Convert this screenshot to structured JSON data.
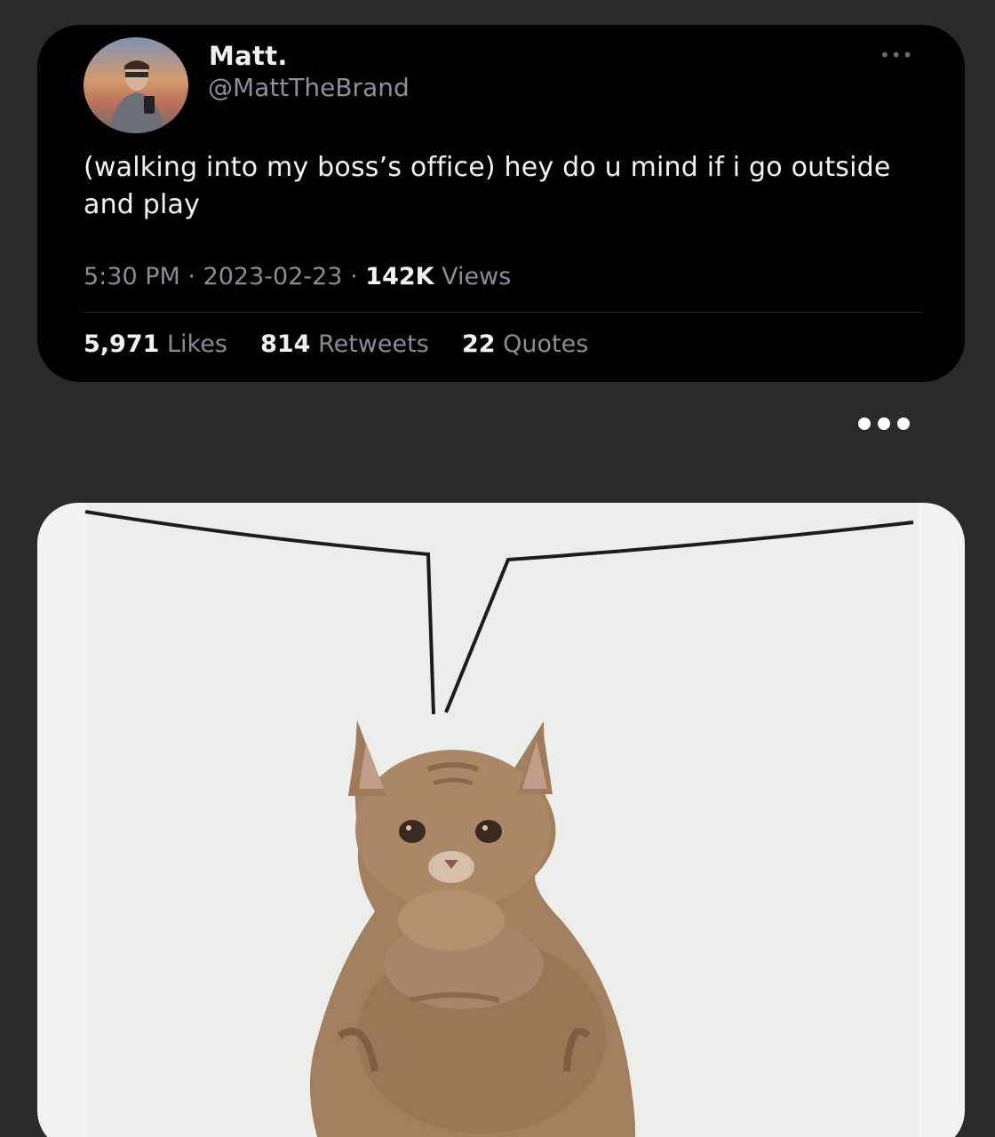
{
  "tweet": {
    "display_name": "Matt.",
    "handle": "@MattTheBrand",
    "text": "(walking into my boss’s office) hey do u mind if i go outside and play",
    "time": "5:30 PM",
    "date": "2023-02-23",
    "views_count": "142K",
    "views_label": "Views",
    "likes_count": "5,971",
    "likes_label": "Likes",
    "retweets_count": "814",
    "retweets_label": "Retweets",
    "quotes_count": "22",
    "quotes_label": "Quotes",
    "separator": "·"
  },
  "icons": {
    "more_small": "ellipsis-icon",
    "more_big": "more-dots-icon"
  },
  "colors": {
    "background": "#2a2a2c",
    "card": "#000000",
    "muted_text": "#8a8d93",
    "primary_text": "#f2f2f2",
    "meme_background": "#eceeec",
    "cat_fur": "#a27f5f"
  }
}
